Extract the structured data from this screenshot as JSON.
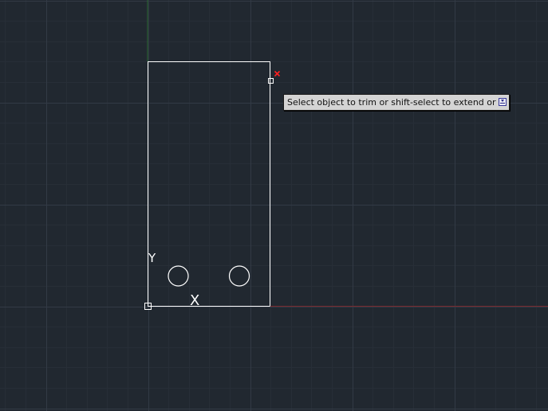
{
  "app": {
    "view": "model-space-drawing-area"
  },
  "colors": {
    "background": "#212830",
    "grid_minor": "#272e37",
    "grid_major": "#323a45",
    "x_axis": "#7a2a2e",
    "y_axis": "#2c6a34",
    "geometry": "#ffffff",
    "pickbox_x": "#ff2020"
  },
  "ucs_icon": {
    "x_label": "X",
    "y_label": "Y"
  },
  "command_prompt": {
    "text": "Select object to trim or shift-select to extend or",
    "options_icon": "dropdown-arrow-icon"
  },
  "cursor": {
    "icon": "pickbox-cursor-icon",
    "badge_icon": "trim-x-badge-icon"
  }
}
